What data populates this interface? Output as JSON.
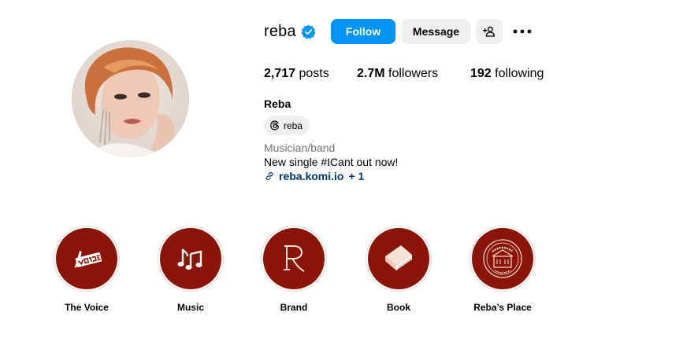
{
  "profile": {
    "username": "reba",
    "full_name": "Reba",
    "threads_handle": "reba",
    "category": "Musician/band",
    "bio": "New single #ICant out now!",
    "link": "reba.komi.io",
    "link_extra": "+ 1"
  },
  "actions": {
    "follow_label": "Follow",
    "message_label": "Message"
  },
  "stats": {
    "posts_count": "2,717",
    "posts_label": "posts",
    "followers_count": "2.7M",
    "followers_label": "followers",
    "following_count": "192",
    "following_label": "following"
  },
  "highlights": [
    {
      "label": "The Voice",
      "icon": "the-voice-logo-icon"
    },
    {
      "label": "Music",
      "icon": "music-notes-icon"
    },
    {
      "label": "Brand",
      "icon": "brand-r-logo-icon"
    },
    {
      "label": "Book",
      "icon": "book-icon"
    },
    {
      "label": "Reba’s Place",
      "icon": "rebas-place-seal-icon"
    }
  ],
  "colors": {
    "accent": "#0095f6",
    "highlight_bg": "#8c1407",
    "link": "#00376b",
    "verified": "#0095f6"
  }
}
